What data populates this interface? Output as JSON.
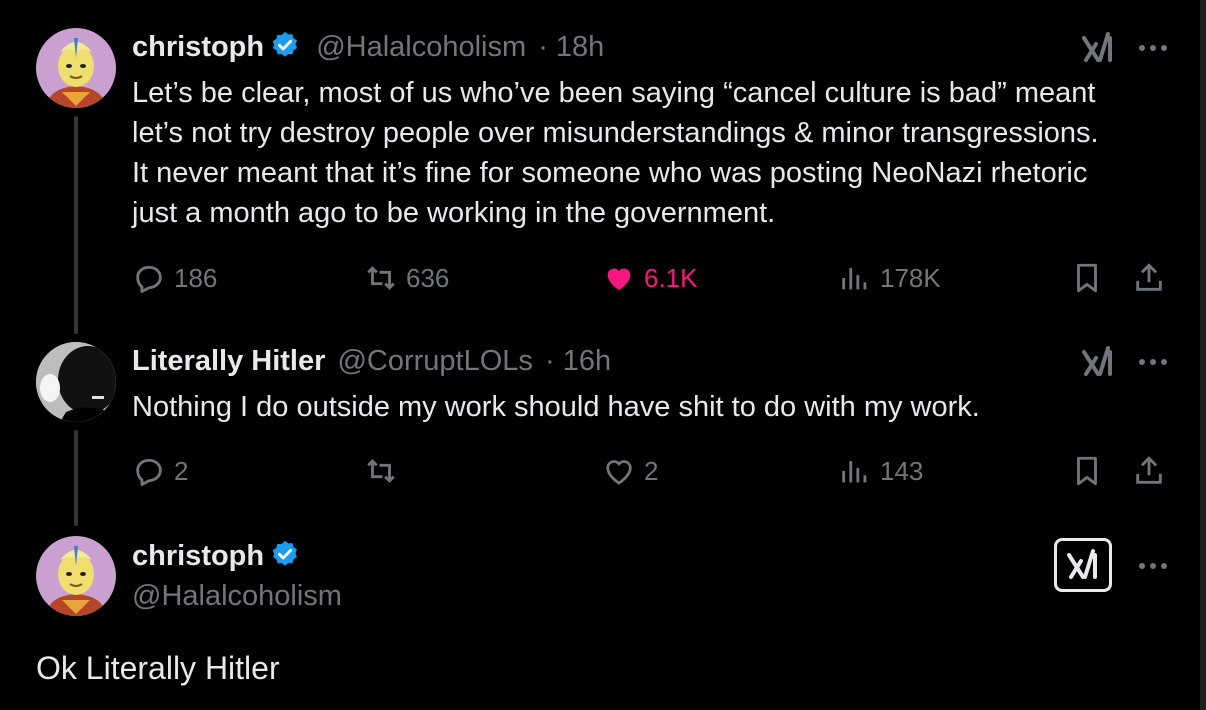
{
  "tweets": [
    {
      "author": "christoph",
      "handle": "@Halalcoholism",
      "time": "· 18h",
      "verified": true,
      "text_lines": [
        "Let’s be clear, most of us who’ve been saying “cancel culture is bad” meant",
        "let’s not try destroy people over misunderstandings & minor transgressions.",
        "It never meant that it’s fine for someone who was posting NeoNazi rhetoric",
        "just a month ago to be working in the government."
      ],
      "replies": "186",
      "reposts": "636",
      "likes": "6.1K",
      "liked": true,
      "views": "178K"
    },
    {
      "author": "Literally Hitler",
      "handle": "@CorruptLOLs",
      "time": "· 16h",
      "verified": false,
      "text_lines": [
        "Nothing I do outside my work should have shit to do with my work."
      ],
      "replies": "2",
      "reposts": "",
      "likes": "2",
      "liked": false,
      "views": "143"
    }
  ],
  "main_tweet": {
    "author": "christoph",
    "handle": "@Halalcoholism",
    "verified": true,
    "text": "Ok Literally Hitler"
  },
  "icons": {
    "reply": "reply-icon",
    "repost": "repost-icon",
    "like": "heart-icon",
    "views": "views-icon",
    "bookmark": "bookmark-icon",
    "share": "share-icon",
    "grok": "grok-icon",
    "more": "more-icon",
    "verified": "verified-badge-icon"
  },
  "colors": {
    "background": "#000000",
    "text": "#e7e9ea",
    "muted": "#71767b",
    "like": "#f91880",
    "verified": "#1d9bf0"
  }
}
